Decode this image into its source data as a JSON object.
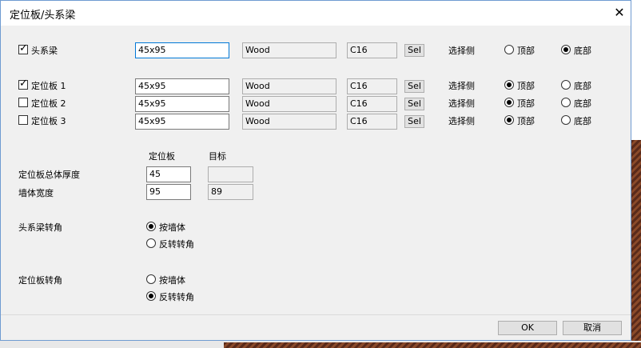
{
  "dialog": {
    "title": "定位板/头系梁",
    "close_glyph": "✕"
  },
  "rows": {
    "header_beam": {
      "label": "头系梁",
      "checked": true,
      "size": "45x95",
      "material": "Wood",
      "grade": "C16",
      "sel_label": "Sel",
      "side_label": "选择侧",
      "top_label": "顶部",
      "bottom_label": "底部",
      "selected_side": "bottom"
    },
    "plate1": {
      "label": "定位板 1",
      "checked": true,
      "size": "45x95",
      "material": "Wood",
      "grade": "C16",
      "sel_label": "Sel",
      "side_label": "选择侧",
      "top_label": "顶部",
      "bottom_label": "底部",
      "selected_side": "top"
    },
    "plate2": {
      "label": "定位板 2",
      "checked": false,
      "size": "45x95",
      "material": "Wood",
      "grade": "C16",
      "sel_label": "Sel",
      "side_label": "选择侧",
      "top_label": "顶部",
      "bottom_label": "底部",
      "selected_side": "top"
    },
    "plate3": {
      "label": "定位板 3",
      "checked": false,
      "size": "45x95",
      "material": "Wood",
      "grade": "C16",
      "sel_label": "Sel",
      "side_label": "选择侧",
      "top_label": "顶部",
      "bottom_label": "底部",
      "selected_side": "top"
    }
  },
  "thickness": {
    "col_plate": "定位板",
    "col_target": "目标",
    "total_label": "定位板总体厚度",
    "total_value": "45",
    "total_target": "",
    "wall_label": "墙体宽度",
    "wall_value": "95",
    "wall_target": "89"
  },
  "header_corner": {
    "label": "头系梁转角",
    "opt_by_wall": "按墙体",
    "opt_reverse": "反转转角",
    "selected": "by_wall"
  },
  "plate_corner": {
    "label": "定位板转角",
    "opt_by_wall": "按墙体",
    "opt_reverse": "反转转角",
    "selected": "reverse"
  },
  "footer": {
    "ok_label": "OK",
    "cancel_label": "取消"
  }
}
